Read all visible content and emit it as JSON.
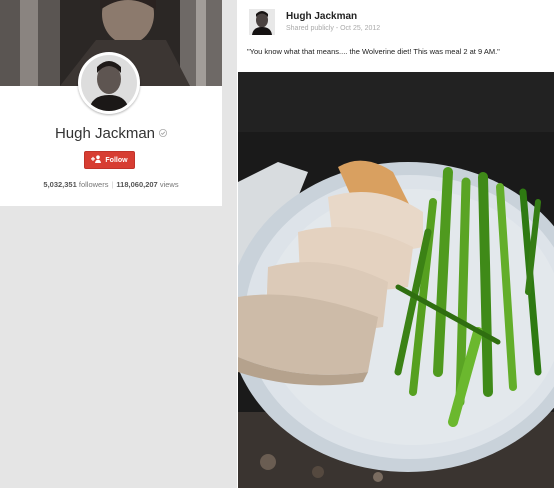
{
  "profile": {
    "name": "Hugh Jackman",
    "follow_label": "Follow",
    "followers": "5,032,351",
    "followers_label": "followers",
    "views": "118,060,207",
    "views_label": "views"
  },
  "post": {
    "author": "Hugh Jackman",
    "visibility": "Shared publicly",
    "date": "Oct 25, 2012",
    "text": "\"You know what that means.... the Wolverine diet! This was meal 2 at 9 AM.\""
  },
  "icons": {
    "verified": "verified-icon",
    "follow": "add-person-icon"
  },
  "colors": {
    "follow_button": "#d73d32"
  }
}
